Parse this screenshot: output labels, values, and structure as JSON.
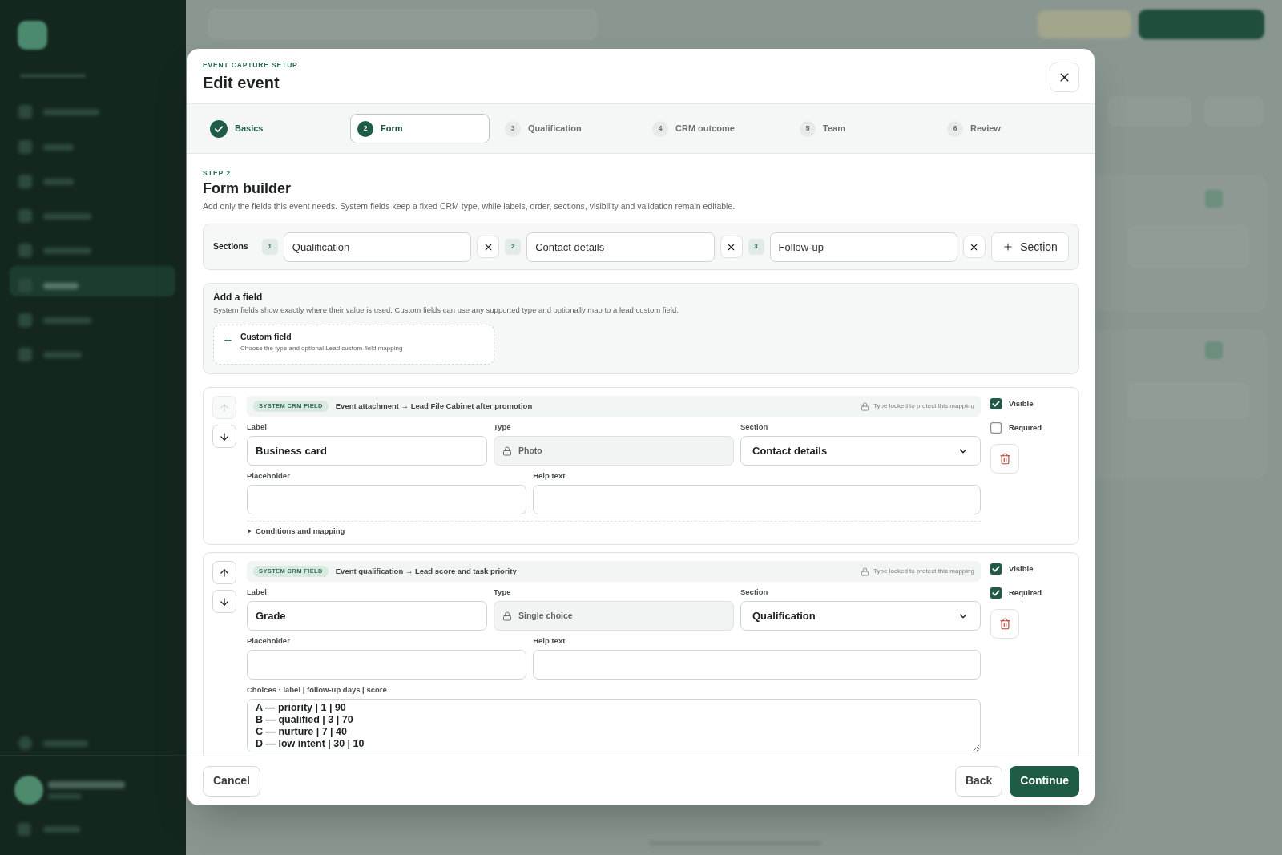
{
  "modal": {
    "eyebrow": "EVENT CAPTURE SETUP",
    "title": "Edit event"
  },
  "steps": [
    {
      "label": "Basics",
      "completed": true,
      "selected": false
    },
    {
      "number": "2",
      "label": "Form",
      "completed": false,
      "selected": true
    },
    {
      "number": "3",
      "label": "Qualification",
      "completed": false,
      "selected": false
    },
    {
      "number": "4",
      "label": "CRM outcome",
      "completed": false,
      "selected": false
    },
    {
      "number": "5",
      "label": "Team",
      "completed": false,
      "selected": false
    },
    {
      "number": "6",
      "label": "Review",
      "completed": false,
      "selected": false
    }
  ],
  "step_heading": {
    "eyebrow": "STEP 2",
    "title": "Form builder",
    "description": "Add only the fields this event needs. System fields keep a fixed CRM type, while labels, order, sections, visibility and validation remain editable."
  },
  "sections": {
    "label": "Sections",
    "items": [
      {
        "number": "1",
        "name": "Qualification"
      },
      {
        "number": "2",
        "name": "Contact details"
      },
      {
        "number": "3",
        "name": "Follow-up"
      }
    ],
    "add_button": "Section"
  },
  "add_field": {
    "title": "Add a field",
    "description": "System fields show exactly where their value is used. Custom fields can use any supported type and optionally map to a lead custom field.",
    "options": [
      {
        "title": "Custom field",
        "description": "Choose the type and optional Lead custom-field mapping"
      }
    ]
  },
  "fields": [
    {
      "badge": "SYSTEM CRM FIELD",
      "mapping": "Event attachment → Lead File Cabinet after promotion",
      "lock_note": "Type locked to protect this mapping",
      "up_disabled": true,
      "label": {
        "caption": "Label",
        "value": "Business card"
      },
      "type": {
        "caption": "Type",
        "value": "Photo"
      },
      "section": {
        "caption": "Section",
        "value": "Contact details"
      },
      "placeholder_field": {
        "caption": "Placeholder"
      },
      "help_text": {
        "caption": "Help text"
      },
      "conditions": {
        "label": "Conditions and mapping",
        "expanded": false
      },
      "visible": {
        "label": "Visible",
        "checked": true
      },
      "required": {
        "label": "Required",
        "checked": false
      }
    },
    {
      "badge": "SYSTEM CRM FIELD",
      "mapping": "Event qualification → Lead score and task priority",
      "lock_note": "Type locked to protect this mapping",
      "up_disabled": false,
      "label": {
        "caption": "Label",
        "value": "Grade"
      },
      "type": {
        "caption": "Type",
        "value": "Single choice"
      },
      "section": {
        "caption": "Section",
        "value": "Qualification"
      },
      "placeholder_field": {
        "caption": "Placeholder"
      },
      "help_text": {
        "caption": "Help text"
      },
      "choices": {
        "caption": "Choices · label | follow-up days | score",
        "value": "A — priority | 1 | 90\nB — qualified | 3 | 70\nC — nurture | 7 | 40\nD — low intent | 30 | 10"
      },
      "visible": {
        "label": "Visible",
        "checked": true
      },
      "required": {
        "label": "Required",
        "checked": true
      }
    }
  ],
  "footer": {
    "cancel": "Cancel",
    "back": "Back",
    "continue": "Continue"
  }
}
